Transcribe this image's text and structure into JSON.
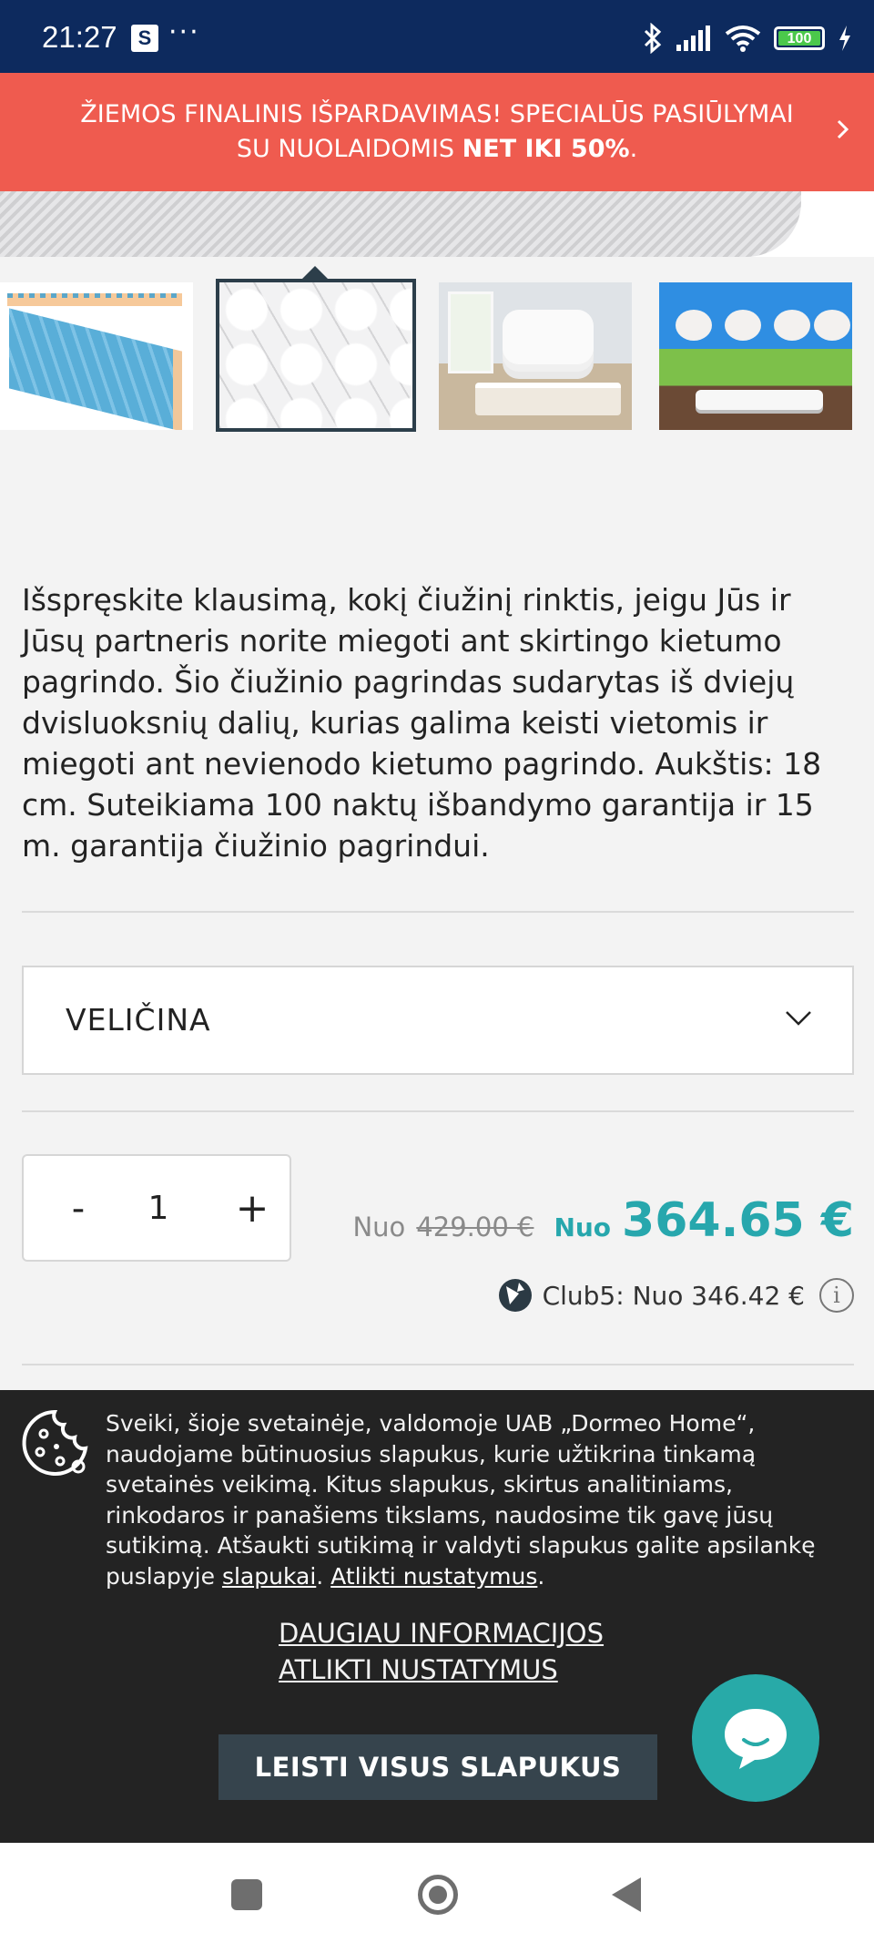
{
  "status_bar": {
    "time": "21:27",
    "app_badge": "S",
    "more": "···",
    "battery": "100"
  },
  "promo": {
    "text_normal": "ŽIEMOS FINALINIS IŠPARDAVIMAS! SPECIALŪS PASIŪLYMAI SU NUOLAIDOMIS ",
    "text_strong": "NET IKI 50%",
    "text_end": "."
  },
  "description": "Išspręskite klausimą, kokį čiužinį rinktis, jeigu Jūs ir Jūsų partneris norite miegoti ant skirtingo kietumo pagrindo. Šio čiužinio pagrindas sudarytas iš dviejų dvisluoksnių dalių, kurias galima keisti vietomis ir miegoti ant nevienodo kietumo pagrindo. Aukštis: 18 cm. Suteikiama 100 naktų išbandymo garantija ir 15 m. garantija čiužinio pagrindui.",
  "size_select": {
    "label": "VELIČINA"
  },
  "quantity": {
    "minus": "-",
    "value": "1",
    "plus": "+"
  },
  "price": {
    "old_prefix": "Nuo",
    "old_value": "429.00 €",
    "new_prefix": "Nuo",
    "new_value": "364.65 €",
    "club_text": "Club5: Nuo 346.42 €",
    "info_symbol": "i"
  },
  "cookie": {
    "text": "Sveiki, šioje svetainėje, valdomoje UAB „Dormeo Home“, naudojame būtinuosius slapukus, kurie užtikrina tinkamą svetainės veikimą. Kitus slapukus, skirtus analitiniams, rinkodaros ir panašiems tikslams, naudosime tik gavę jūsų sutikimą. Atšaukti sutikimą ir valdyti slapukus galite apsilankę puslapyje ",
    "link_cookies": "slapukai",
    "separator": ". ",
    "link_settings": "Atlikti nustatymus",
    "end": ".",
    "more_info": "DAUGIAU INFORMACIJOS",
    "do_settings": "ATLIKTI NUSTATYMUS",
    "accept_all": "LEISTI VISUS SLAPUKUS"
  },
  "colors": {
    "status_bar": "#0d2a5e",
    "promo": "#ef5b4f",
    "accent": "#27a7ad",
    "cookie_bg": "#232323"
  }
}
